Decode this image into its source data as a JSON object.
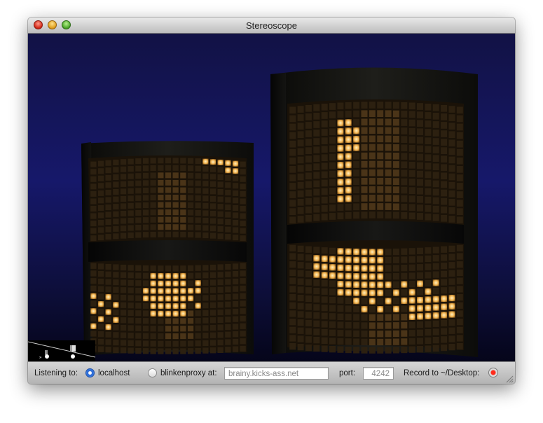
{
  "window": {
    "title": "Stereoscope"
  },
  "scene": {
    "description_icons": [
      "zoom-slider-icon",
      "camera-icon"
    ],
    "colors": {
      "lit": "#ffd27a",
      "dim": "#3a2a14",
      "background": "#15165e"
    }
  },
  "statusbar": {
    "listening_label": "Listening to:",
    "localhost_label": "localhost",
    "localhost_selected": true,
    "proxy_label": "blinkenproxy at:",
    "proxy_selected": false,
    "proxy_host": "brainy.kicks-ass.net",
    "port_label": "port:",
    "port_value": "4242",
    "record_label": "Record to ~/Desktop:"
  }
}
